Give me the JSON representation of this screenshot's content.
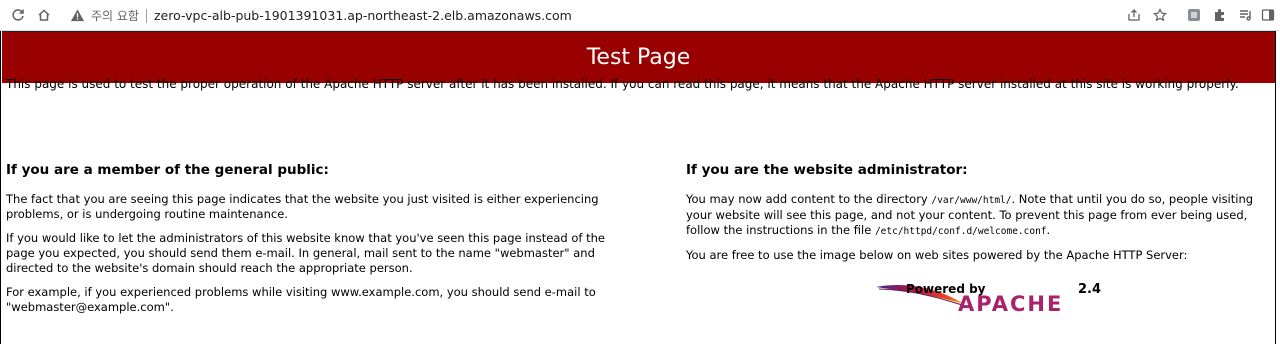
{
  "browser": {
    "warning_text": "주의 요함",
    "url": "zero-vpc-alb-pub-1901391031.ap-northeast-2.elb.amazonaws.com"
  },
  "page": {
    "banner_title": "Test Page",
    "intro": "This page is used to test the proper operation of the Apache HTTP server after it has been installed. If you can read this page, it means that the Apache HTTP server installed at this site is working properly.",
    "public": {
      "heading": "If you are a member of the general public:",
      "p1": "The fact that you are seeing this page indicates that the website you just visited is either experiencing problems, or is undergoing routine maintenance.",
      "p2": "If you would like to let the administrators of this website know that you've seen this page instead of the page you expected, you should send them e-mail. In general, mail sent to the name \"webmaster\" and directed to the website's domain should reach the appropriate person.",
      "p3": "For example, if you experienced problems while visiting www.example.com, you should send e-mail to \"webmaster@example.com\"."
    },
    "admin": {
      "heading": "If you are the website administrator:",
      "p1_a": "You may now add content to the directory ",
      "p1_code1": "/var/www/html/",
      "p1_b": ". Note that until you do so, people visiting your website will see this page, and not your content. To prevent this page from ever being used, follow the instructions in the file ",
      "p1_code2": "/etc/httpd/conf.d/welcome.conf",
      "p1_c": ".",
      "p2": "You are free to use the image below on web sites powered by the Apache HTTP Server:",
      "logo_powered": "Powered by",
      "logo_version": "2.4",
      "logo_name": "APACHE"
    }
  }
}
